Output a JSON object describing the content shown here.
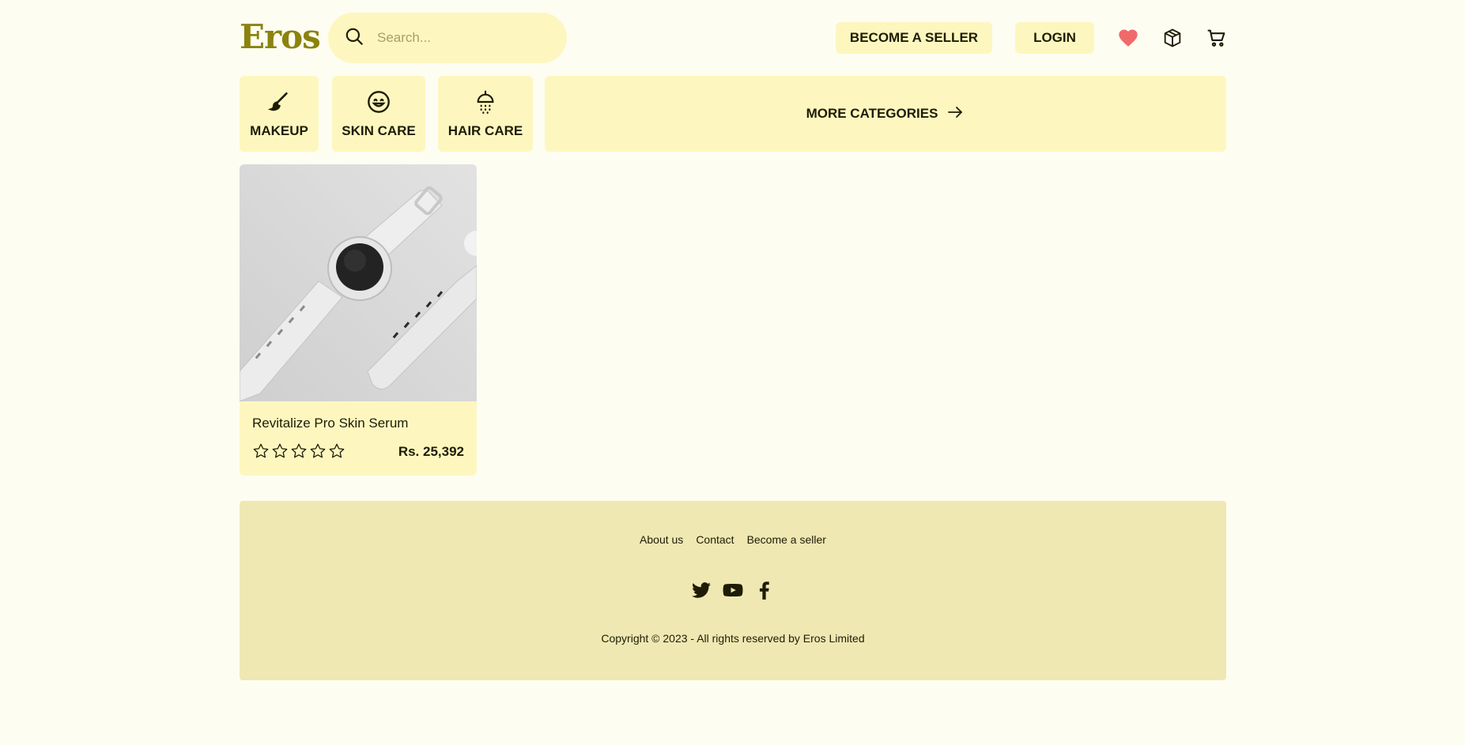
{
  "header": {
    "logo": "Eros",
    "search": {
      "placeholder": "Search...",
      "icon": "search-icon"
    },
    "become_seller": "BECOME A SELLER",
    "login": "LOGIN",
    "icons": [
      "heart-icon",
      "box-icon",
      "cart-icon"
    ]
  },
  "categories": [
    {
      "label": "MAKEUP",
      "icon": "brush-icon"
    },
    {
      "label": "SKIN CARE",
      "icon": "smile-icon"
    },
    {
      "label": "HAIR CARE",
      "icon": "shower-icon"
    }
  ],
  "more_categories": {
    "label": "MORE CATEGORIES",
    "icon": "arrow-right-icon"
  },
  "products": [
    {
      "name": "Revitalize Pro Skin Serum",
      "price": "Rs. 25,392",
      "rating": 0,
      "max_rating": 5
    }
  ],
  "footer": {
    "links": [
      "About us",
      "Contact",
      "Become a seller"
    ],
    "socials": [
      "twitter-icon",
      "youtube-icon",
      "facebook-icon"
    ],
    "copyright": "Copyright © 2023 - All rights reserved by Eros Limited"
  },
  "colors": {
    "background": "#fefdf2",
    "accent": "#fdf7bf",
    "logo": "#8b830e",
    "footer": "#efe8b2",
    "heart": "#f06a6a"
  }
}
